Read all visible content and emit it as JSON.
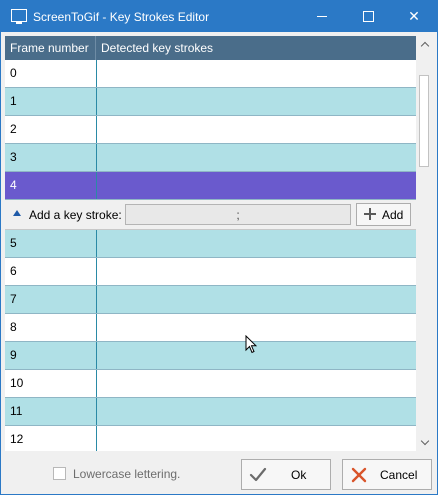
{
  "window": {
    "title": "ScreenToGif - Key Strokes Editor",
    "icons": {
      "app": "screentogif-app-icon",
      "minimize": "minimize-icon",
      "maximize": "maximize-icon",
      "close": "close-icon"
    },
    "close_glyph": "✕"
  },
  "table": {
    "columns": [
      "Frame number",
      "Detected key strokes"
    ],
    "rows_before": [
      {
        "frame": "0",
        "keys": ""
      },
      {
        "frame": "1",
        "keys": ""
      },
      {
        "frame": "2",
        "keys": ""
      },
      {
        "frame": "3",
        "keys": ""
      },
      {
        "frame": "4",
        "keys": ""
      }
    ],
    "selected_row_index": 4,
    "rows_after": [
      {
        "frame": "5",
        "keys": ""
      },
      {
        "frame": "6",
        "keys": ""
      },
      {
        "frame": "7",
        "keys": ""
      },
      {
        "frame": "8",
        "keys": ""
      },
      {
        "frame": "9",
        "keys": ""
      },
      {
        "frame": "10",
        "keys": ""
      },
      {
        "frame": "11",
        "keys": ""
      },
      {
        "frame": "12",
        "keys": ""
      }
    ],
    "colors": {
      "header": "#4a6d8a",
      "alt_row": "#b0e0e6",
      "selected_row": "#6a5acd"
    }
  },
  "row_detail": {
    "label": "Add a key stroke:",
    "input_value": ";",
    "add_button": "Add",
    "icons": {
      "toggle": "collapse-triangle-icon",
      "add": "plus-icon"
    }
  },
  "footer": {
    "checkbox_label": "Lowercase lettering.",
    "checkbox_checked": false,
    "ok_label": "Ok",
    "cancel_label": "Cancel",
    "icons": {
      "ok": "checkmark-icon",
      "cancel": "cancel-x-icon"
    },
    "colors": {
      "cancel_icon": "#d9542a",
      "ok_icon": "#6b6b6b"
    }
  }
}
